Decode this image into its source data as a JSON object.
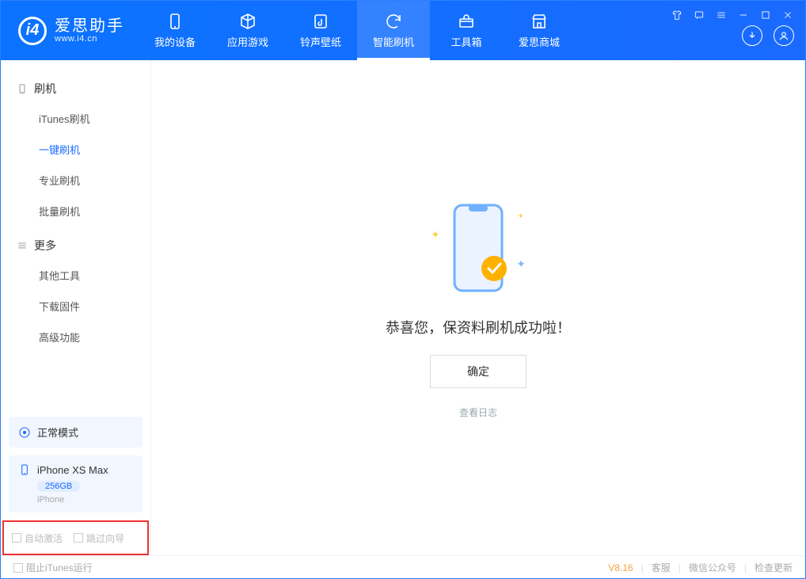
{
  "app": {
    "title": "爱思助手",
    "subtitle": "www.i4.cn"
  },
  "nav": [
    {
      "label": "我的设备",
      "icon": "device"
    },
    {
      "label": "应用游戏",
      "icon": "cube"
    },
    {
      "label": "铃声壁纸",
      "icon": "music"
    },
    {
      "label": "智能刷机",
      "icon": "refresh",
      "active": true
    },
    {
      "label": "工具箱",
      "icon": "toolbox"
    },
    {
      "label": "爱思商城",
      "icon": "store"
    }
  ],
  "sidebar": {
    "sections": [
      {
        "title": "刷机",
        "icon": "phone",
        "items": [
          "iTunes刷机",
          "一键刷机",
          "专业刷机",
          "批量刷机"
        ],
        "active_index": 1
      },
      {
        "title": "更多",
        "icon": "menu",
        "items": [
          "其他工具",
          "下载固件",
          "高级功能"
        ],
        "active_index": -1
      }
    ]
  },
  "mode_card": {
    "label": "正常模式"
  },
  "device_card": {
    "name": "iPhone XS Max",
    "capacity": "256GB",
    "type": "iPhone"
  },
  "red_options": {
    "auto_activate": "自动激活",
    "skip_guide": "跳过向导"
  },
  "main": {
    "message": "恭喜您，保资料刷机成功啦！",
    "ok": "确定",
    "log_link": "查看日志"
  },
  "footer": {
    "block_itunes": "阻止iTunes运行",
    "version": "V8.16",
    "links": [
      "客服",
      "微信公众号",
      "检查更新"
    ]
  }
}
